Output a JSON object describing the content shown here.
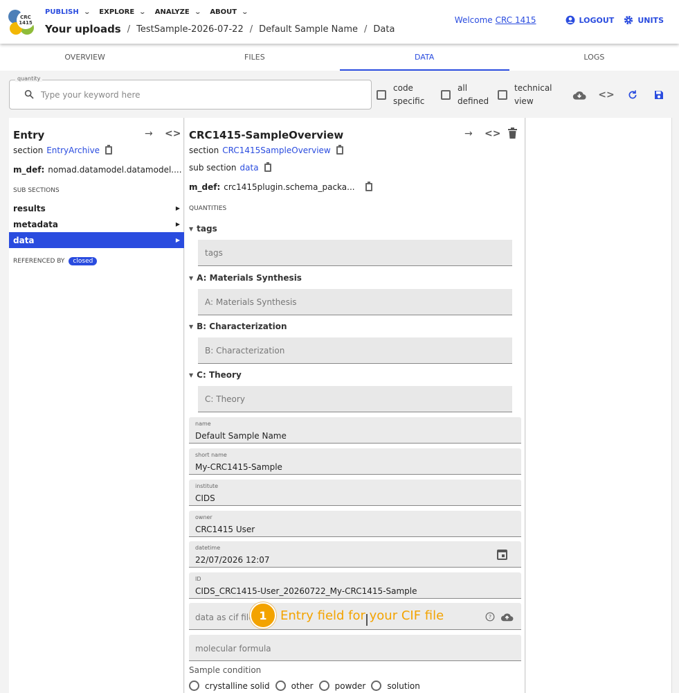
{
  "header": {
    "logo_text": "CRC 1415",
    "nav": [
      {
        "label": "PUBLISH",
        "active": true
      },
      {
        "label": "EXPLORE",
        "active": false
      },
      {
        "label": "ANALYZE",
        "active": false
      },
      {
        "label": "ABOUT",
        "active": false
      }
    ],
    "breadcrumb": {
      "root": "Your uploads",
      "items": [
        "TestSample-2026-07-22",
        "Default Sample Name",
        "Data"
      ]
    },
    "welcome": "Welcome",
    "username": "CRC 1415",
    "logout": "LOGOUT",
    "units": "UNITS"
  },
  "tabs": [
    "OVERVIEW",
    "FILES",
    "DATA",
    "LOGS"
  ],
  "active_tab": "DATA",
  "search": {
    "legend": "quantity",
    "placeholder": "Type your keyword here",
    "value": ""
  },
  "filters": {
    "code_specific": "code specific",
    "all_defined": "all defined",
    "technical_view": "technical view"
  },
  "left_panel": {
    "title": "Entry",
    "section_label": "section",
    "section_link": "EntryArchive",
    "mdef_label": "m_def:",
    "mdef_value": "nomad.datamodel.datamodel....",
    "subsections_label": "SUB SECTIONS",
    "subsections": [
      "results",
      "metadata",
      "data"
    ],
    "selected": "data",
    "referenced_by_label": "REFERENCED BY",
    "referenced_by_badge": "closed"
  },
  "main_panel": {
    "title": "CRC1415-SampleOverview",
    "section_label": "section",
    "section_link": "CRC1415SampleOverview",
    "subsection_label": "sub section",
    "subsection_link": "data",
    "mdef_label": "m_def:",
    "mdef_value": "crc1415plugin.schema_packa...",
    "quantities_label": "QUANTITIES",
    "groups": [
      {
        "heading": "tags",
        "placeholder": "tags"
      },
      {
        "heading": "A: Materials Synthesis",
        "placeholder": "A: Materials Synthesis"
      },
      {
        "heading": "B: Characterization",
        "placeholder": "B: Characterization"
      },
      {
        "heading": "C: Theory",
        "placeholder": "C: Theory"
      }
    ],
    "fields": {
      "name": {
        "label": "name",
        "value": "Default Sample Name"
      },
      "short_name": {
        "label": "short name",
        "value": "My-CRC1415-Sample"
      },
      "institute": {
        "label": "institute",
        "value": "CIDS"
      },
      "owner": {
        "label": "owner",
        "value": "CRC1415 User"
      },
      "datetime": {
        "label": "datetime",
        "value": "22/07/2026 12:07"
      },
      "id": {
        "label": "ID",
        "value": "CIDS_CRC1415-User_20260722_My-CRC1415-Sample"
      },
      "cif": {
        "placeholder": "data as cif file"
      },
      "formula": {
        "placeholder": "molecular formula"
      }
    },
    "annotation": {
      "number": "1",
      "text": "Entry field for your CIF file"
    },
    "sample_condition": {
      "label": "Sample condition",
      "options": [
        "crystalline solid",
        "other",
        "powder",
        "solution"
      ]
    }
  },
  "colors": {
    "accent": "#2a4cdf",
    "annotation": "#f3a300"
  }
}
